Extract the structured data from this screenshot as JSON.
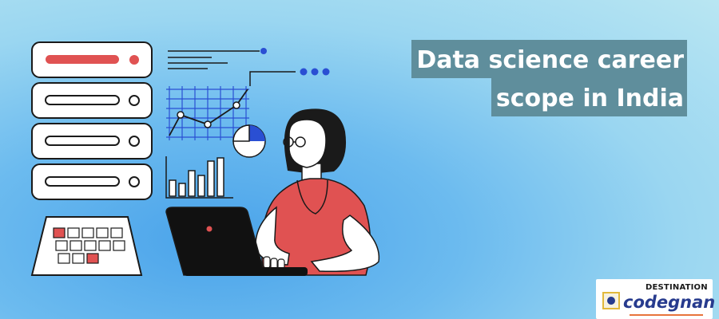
{
  "banner": {
    "title_line1": "Data science career",
    "title_line2": "scope in India"
  },
  "logo": {
    "top_text": "DESTINATION",
    "wordmark": "codegnan",
    "trademark": "®"
  },
  "colors": {
    "accent_red": "#e05252",
    "ink": "#1a1a1a",
    "title_bg": "#5f8e9c",
    "blue_accent": "#2a4fd3"
  },
  "icons": {
    "server_stack": "server-stack-icon",
    "chart": "line-chart-icon",
    "pie": "pie-chart-icon",
    "bars": "bar-chart-icon",
    "calendar": "calendar-icon",
    "laptop": "laptop-icon",
    "person": "woman-with-glasses"
  }
}
